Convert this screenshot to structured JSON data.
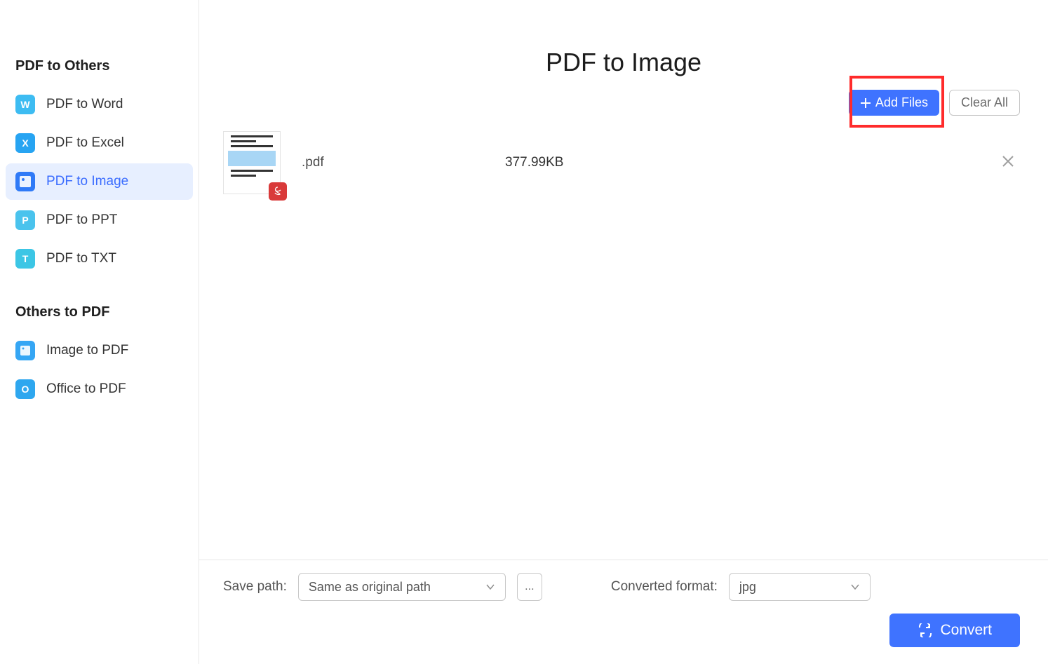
{
  "window": {
    "menu_icon": "menu",
    "minimize_icon": "minimize",
    "close_icon": "close"
  },
  "sidebar": {
    "section1_title": "PDF to Others",
    "section2_title": "Others to PDF",
    "items1": [
      {
        "label": "PDF to Word",
        "icon": "W"
      },
      {
        "label": "PDF to Excel",
        "icon": "X"
      },
      {
        "label": "PDF to Image",
        "icon": ""
      },
      {
        "label": "PDF to PPT",
        "icon": "P"
      },
      {
        "label": "PDF to TXT",
        "icon": "T"
      }
    ],
    "items2": [
      {
        "label": "Image to PDF",
        "icon": ""
      },
      {
        "label": "Office to PDF",
        "icon": "O"
      }
    ]
  },
  "main": {
    "title": "PDF to Image",
    "add_files_label": "Add Files",
    "clear_all_label": "Clear All"
  },
  "files": [
    {
      "name_blurred": "      ",
      "name_suffix": ".pdf",
      "size": "377.99KB"
    }
  ],
  "footer": {
    "save_path_label": "Save path:",
    "save_path_value": "Same as original path",
    "browse_label": "...",
    "format_label": "Converted format:",
    "format_value": "jpg",
    "convert_label": "Convert"
  }
}
